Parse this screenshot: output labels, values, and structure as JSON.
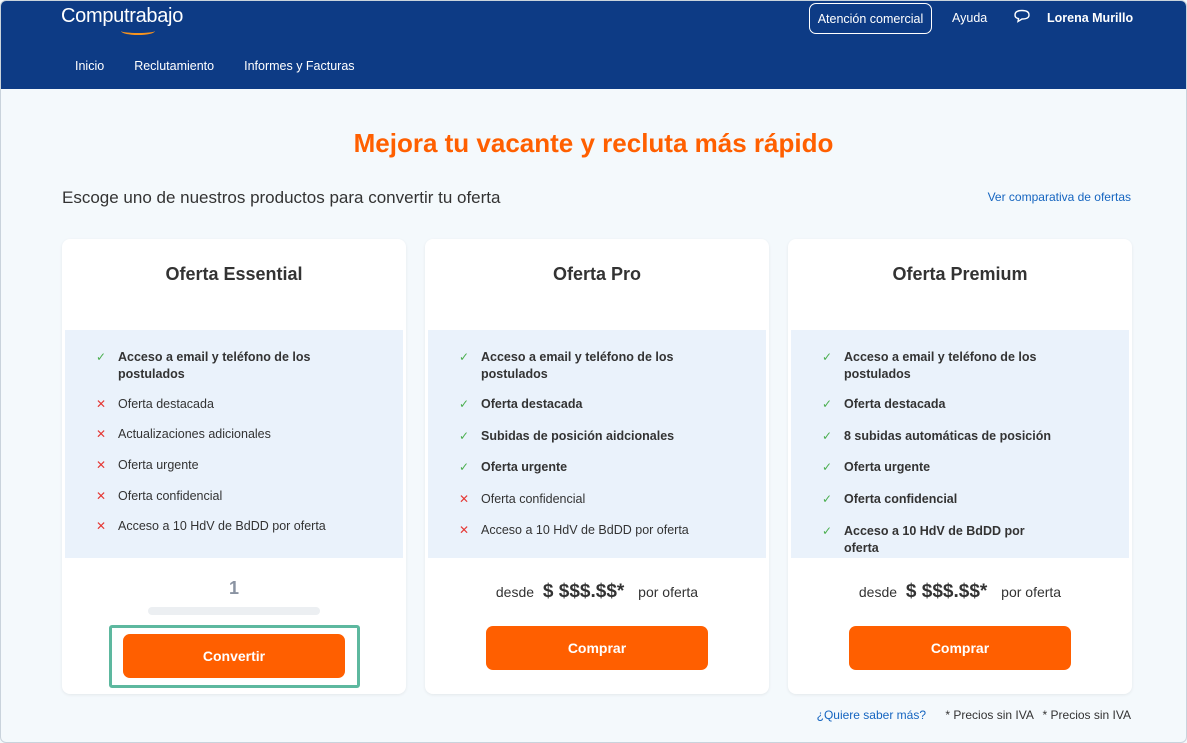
{
  "header": {
    "logo": "Computrabajo",
    "atencion_label": "Atención comercial",
    "ayuda_label": "Ayuda",
    "user_name": "Lorena Murillo",
    "nav": [
      "Inicio",
      "Reclutamiento",
      "Informes y Facturas"
    ]
  },
  "main": {
    "title": "Mejora tu vacante y recluta más rápido",
    "subtitle": "Escoge uno de nuestros productos para convertir tu oferta",
    "comparativa_link": "Ver comparativa de ofertas"
  },
  "plans": [
    {
      "title": "Oferta Essential",
      "features": [
        {
          "text": "Acceso a email y teléfono de los postulados",
          "included": true
        },
        {
          "text": "Oferta destacada",
          "included": false
        },
        {
          "text": "Actualizaciones adicionales",
          "included": false
        },
        {
          "text": "Oferta urgente",
          "included": false
        },
        {
          "text": "Oferta confidencial",
          "included": false
        },
        {
          "text": "Acceso a 10 HdV de BdDD por oferta",
          "included": false
        }
      ],
      "quantity": "1",
      "button_label": "Convertir"
    },
    {
      "title": "Oferta Pro",
      "features": [
        {
          "text": "Acceso a email y teléfono de los postulados",
          "included": true
        },
        {
          "text": "Oferta destacada",
          "included": true
        },
        {
          "text": "Subidas de posición aidcionales",
          "included": true
        },
        {
          "text": "Oferta urgente",
          "included": true
        },
        {
          "text": "Oferta confidencial",
          "included": false
        },
        {
          "text": "Acceso a 10 HdV de BdDD por oferta",
          "included": false
        }
      ],
      "price_prefix": "desde",
      "price": "$ $$$.$$*",
      "price_suffix": "por oferta",
      "button_label": "Comprar"
    },
    {
      "title": "Oferta Premium",
      "features": [
        {
          "text": "Acceso a email y teléfono de los postulados",
          "included": true
        },
        {
          "text": "Oferta destacada",
          "included": true
        },
        {
          "text": "8 subidas automáticas de posición",
          "included": true
        },
        {
          "text": "Oferta urgente",
          "included": true
        },
        {
          "text": "Oferta confidencial",
          "included": true
        },
        {
          "text": "Acceso a 10 HdV de BdDD por oferta",
          "included": true
        }
      ],
      "price_prefix": "desde",
      "price": "$ $$$.$$*",
      "price_suffix": "por oferta",
      "button_label": "Comprar"
    }
  ],
  "footer": {
    "link": "¿Quiere saber más?",
    "note1": "* Precios sin IVA",
    "note2": "* Precios sin IVA"
  },
  "marks": {
    "yes": "✓",
    "no": "✕"
  },
  "colors": {
    "header_bg": "#0d3b85",
    "accent": "#ff5f00",
    "link": "#1565c0",
    "check": "#4caf50",
    "cross": "#e53935"
  }
}
